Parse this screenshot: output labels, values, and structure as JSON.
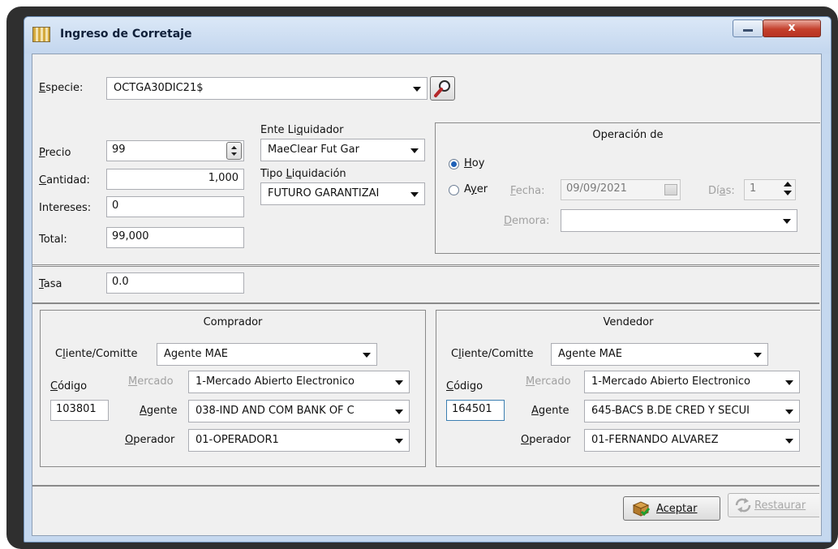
{
  "window": {
    "title": "Ingreso de Corretaje",
    "close_glyph": "x"
  },
  "especie": {
    "label": "Especie:",
    "value": "OCTGA30DIC21$"
  },
  "precio": {
    "label": "Precio",
    "value": "99"
  },
  "cantidad": {
    "label": "Cantidad:",
    "value": "1,000"
  },
  "intereses": {
    "label": "Intereses:",
    "value": "0"
  },
  "total": {
    "label": "Total:",
    "value": "99,000"
  },
  "ente_liquidador": {
    "label": "Ente Liquidador",
    "value": "MaeClear Fut Gar"
  },
  "tipo_liquidacion": {
    "label": "Tipo Liquidación",
    "value": "FUTURO GARANTIZAI"
  },
  "operacion": {
    "title": "Operación de",
    "hoy_label": "Hoy",
    "ayer_label": "Ayer",
    "selected": "Hoy",
    "fecha_label": "Fecha:",
    "fecha_value": "09/09/2021",
    "dias_label": "Días:",
    "dias_value": "1",
    "demora_label": "Demora:",
    "demora_value": ""
  },
  "tasa": {
    "label": "Tasa",
    "value": "0.0"
  },
  "comprador": {
    "title": "Comprador",
    "cliente_label": "Cliente/Comitte",
    "cliente_value": "Agente MAE",
    "codigo_label": "Código",
    "codigo_value": "103801",
    "mercado_label": "Mercado",
    "mercado_value": "1-Mercado Abierto Electronico",
    "agente_label": "Agente",
    "agente_value": "038-IND AND COM BANK OF C",
    "operador_label": "Operador",
    "operador_value": "01-OPERADOR1"
  },
  "vendedor": {
    "title": "Vendedor",
    "cliente_label": "Cliente/Comitte",
    "cliente_value": "Agente MAE",
    "codigo_label": "Código",
    "codigo_value": "164501",
    "mercado_label": "Mercado",
    "mercado_value": "1-Mercado Abierto Electronico",
    "agente_label": "Agente",
    "agente_value": "645-BACS B.DE CRED Y SECUI",
    "operador_label": "Operador",
    "operador_value": "01-FERNANDO ALVAREZ"
  },
  "buttons": {
    "aceptar": "Aceptar",
    "restaurar": "Restaurar"
  },
  "colors": {
    "title_bar": "#c5d8ef",
    "close_button": "#c4402c",
    "radio_selected": "#1f61b7"
  },
  "icons": [
    "grid-app-icon",
    "magnifier-icon",
    "spinner-icon",
    "calendar-icon",
    "accept-package-icon",
    "restore-arrows-icon"
  ]
}
